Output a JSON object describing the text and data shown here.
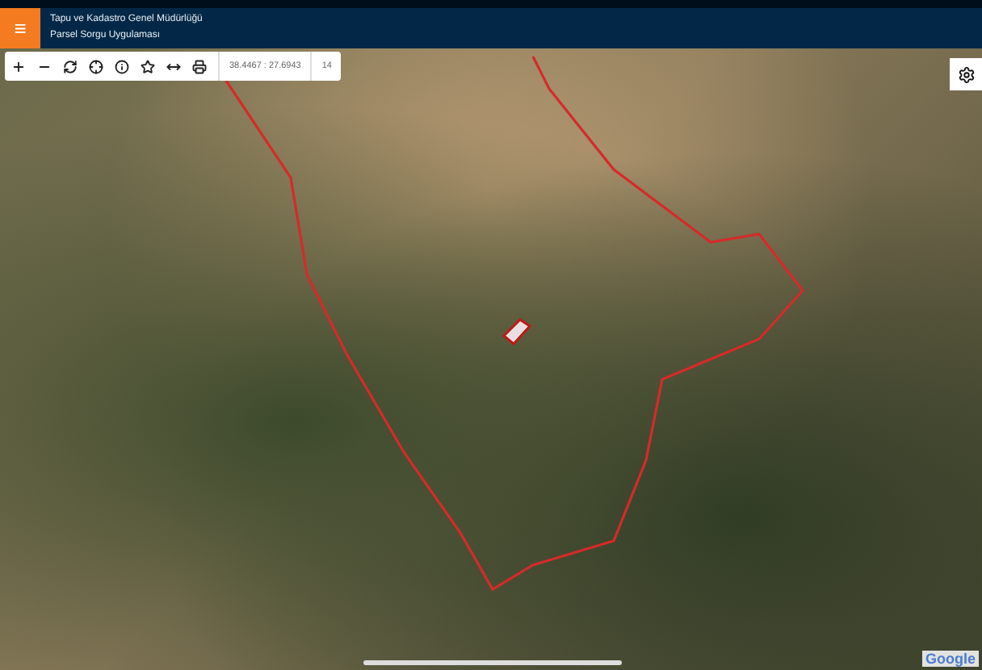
{
  "header": {
    "menu_icon": "≡",
    "title_lines": [
      "Tapu ve Kadastro Genel Müdürlüğü",
      "Parsel Sorgu Uygulaması"
    ]
  },
  "toolbar": {
    "tools": [
      {
        "kind": "zoom-in"
      },
      {
        "kind": "zoom-out"
      },
      {
        "kind": "refresh"
      },
      {
        "kind": "locate"
      },
      {
        "kind": "info"
      },
      {
        "kind": "favorite"
      },
      {
        "kind": "measure"
      },
      {
        "kind": "print"
      }
    ],
    "coordinates": "38.4467 : 27.6943",
    "zoom_level": "14"
  },
  "map": {
    "attribution": "Google"
  }
}
